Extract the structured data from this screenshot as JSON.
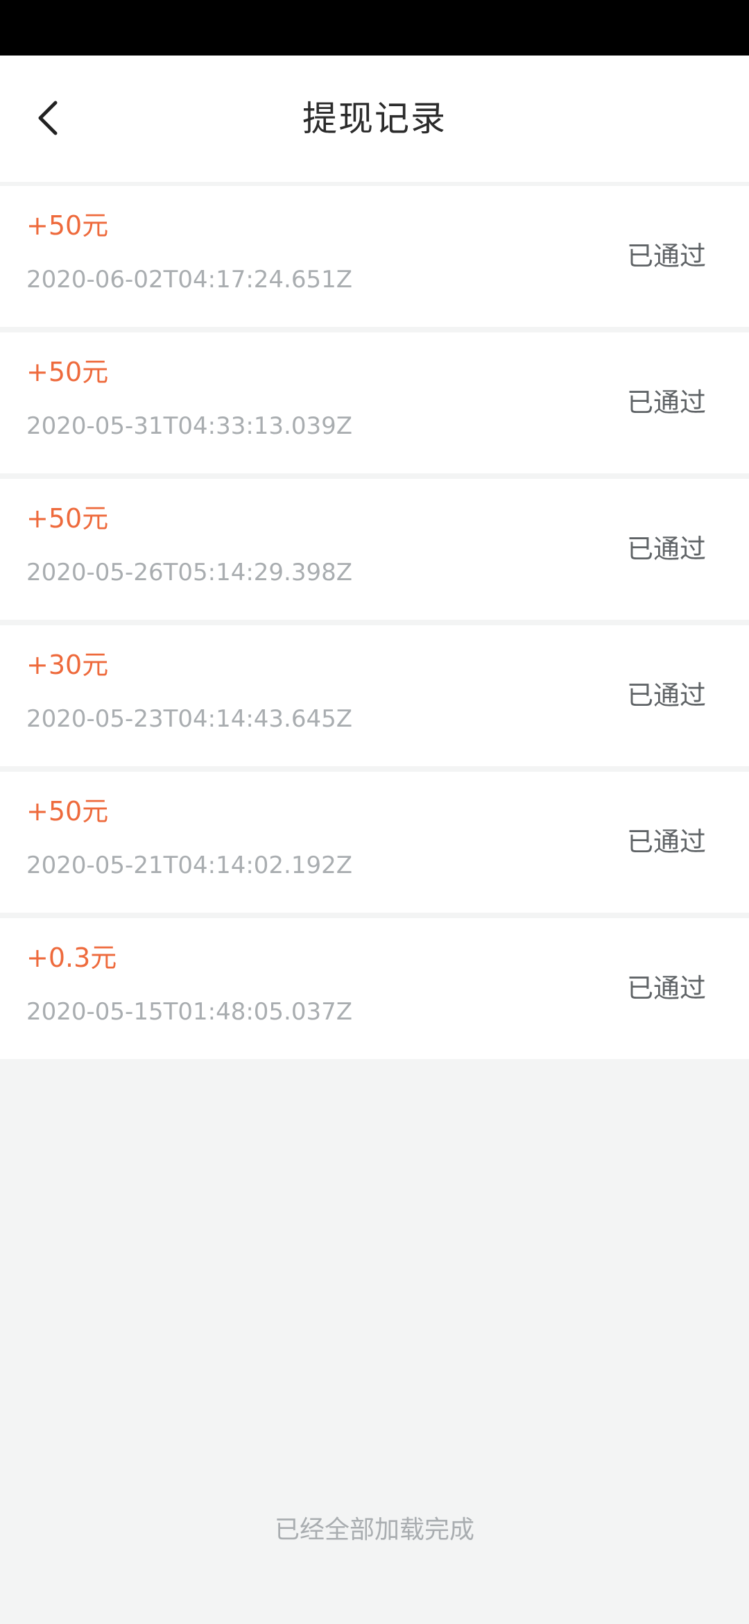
{
  "header": {
    "title": "提现记录"
  },
  "records": [
    {
      "amount": "+50元",
      "time": "2020-06-02T04:17:24.651Z",
      "status": "已通过"
    },
    {
      "amount": "+50元",
      "time": "2020-05-31T04:33:13.039Z",
      "status": "已通过"
    },
    {
      "amount": "+50元",
      "time": "2020-05-26T05:14:29.398Z",
      "status": "已通过"
    },
    {
      "amount": "+30元",
      "time": "2020-05-23T04:14:43.645Z",
      "status": "已通过"
    },
    {
      "amount": "+50元",
      "time": "2020-05-21T04:14:02.192Z",
      "status": "已通过"
    },
    {
      "amount": "+0.3元",
      "time": "2020-05-15T01:48:05.037Z",
      "status": "已通过"
    }
  ],
  "footer": {
    "text": "已经全部加载完成"
  },
  "colors": {
    "amount": "#ee6a3c",
    "status": "#5f6366",
    "muted": "#a9adb0",
    "background": "#f3f4f4"
  },
  "icons": {
    "back": "chevron-left-icon"
  }
}
